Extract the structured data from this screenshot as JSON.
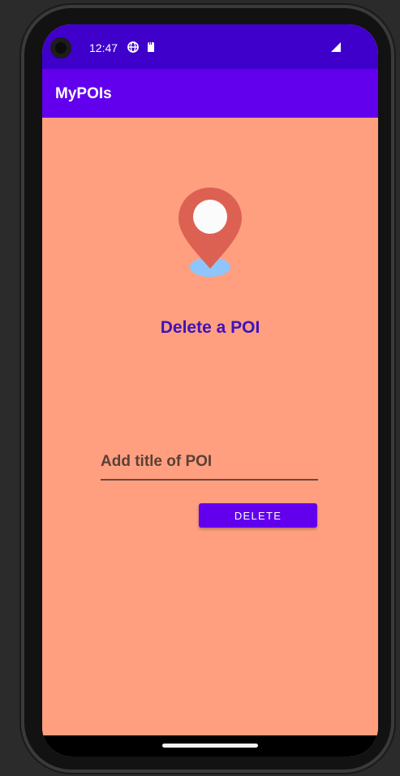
{
  "status_bar": {
    "time": "12:47",
    "icons": [
      "camera-hole-icon",
      "globe-icon",
      "sd-card-icon",
      "signal-icon"
    ],
    "color": "#3F00CC"
  },
  "app_bar": {
    "title": "MyPOIs",
    "color": "#6200EE"
  },
  "content": {
    "background": "#FF9F80",
    "icon": "location-pin-icon",
    "heading": "Delete a POI",
    "title_input": {
      "value": "",
      "placeholder": "Add title of POI"
    },
    "delete_button_label": "DELETE"
  },
  "nav_bar": {
    "indicator": "home-indicator"
  }
}
